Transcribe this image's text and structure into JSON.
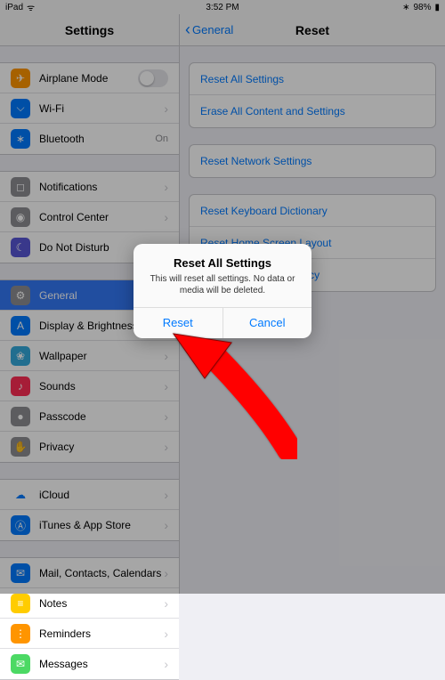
{
  "statusbar": {
    "device": "iPad",
    "time": "3:52 PM",
    "battery": "98%"
  },
  "sidebar": {
    "title": "Settings",
    "g1": [
      {
        "icon": "✈︎",
        "bg": "#ff9500",
        "label": "Airplane Mode",
        "toggle": true
      },
      {
        "icon": "⌵",
        "bg": "#007aff",
        "label": "Wi-Fi",
        "chev": true
      },
      {
        "icon": "∗",
        "bg": "#007aff",
        "label": "Bluetooth",
        "value": "On"
      }
    ],
    "g2": [
      {
        "icon": "◻︎",
        "bg": "#8e8e93",
        "label": "Notifications",
        "chev": true
      },
      {
        "icon": "◉",
        "bg": "#8e8e93",
        "label": "Control Center",
        "chev": true
      },
      {
        "icon": "☾",
        "bg": "#5856d6",
        "label": "Do Not Disturb",
        "chev": true
      }
    ],
    "g3": [
      {
        "icon": "⚙",
        "bg": "#8e8e93",
        "label": "General",
        "sel": true
      },
      {
        "icon": "A",
        "bg": "#007aff",
        "label": "Display & Brightness",
        "chev": true
      },
      {
        "icon": "❀",
        "bg": "#34aadc",
        "label": "Wallpaper",
        "chev": true
      },
      {
        "icon": "♪",
        "bg": "#ff2d55",
        "label": "Sounds",
        "chev": true
      },
      {
        "icon": "●",
        "bg": "#8e8e93",
        "label": "Passcode",
        "chev": true
      },
      {
        "icon": "✋",
        "bg": "#8e8e93",
        "label": "Privacy",
        "chev": true
      }
    ],
    "g4": [
      {
        "icon": "☁",
        "bg": "#fff",
        "fg": "#007aff",
        "label": "iCloud",
        "chev": true
      },
      {
        "icon": "Ⓐ",
        "bg": "#007aff",
        "label": "iTunes & App Store",
        "chev": true
      }
    ],
    "g5": [
      {
        "icon": "✉",
        "bg": "#007aff",
        "label": "Mail, Contacts, Calendars",
        "chev": true
      },
      {
        "icon": "≡",
        "bg": "#ffcc00",
        "label": "Notes",
        "chev": true
      },
      {
        "icon": "⋮",
        "bg": "#ff9500",
        "label": "Reminders",
        "chev": true
      },
      {
        "icon": "✉",
        "bg": "#4cd964",
        "label": "Messages",
        "chev": true
      }
    ]
  },
  "detail": {
    "back": "General",
    "title": "Reset",
    "g1": [
      "Reset All Settings",
      "Erase All Content and Settings"
    ],
    "g2": [
      "Reset Network Settings"
    ],
    "g3": [
      "Reset Keyboard Dictionary",
      "Reset Home Screen Layout",
      "Reset Location & Privacy"
    ]
  },
  "alert": {
    "title": "Reset All Settings",
    "message": "This will reset all settings. No data or media will be deleted.",
    "reset": "Reset",
    "cancel": "Cancel"
  }
}
